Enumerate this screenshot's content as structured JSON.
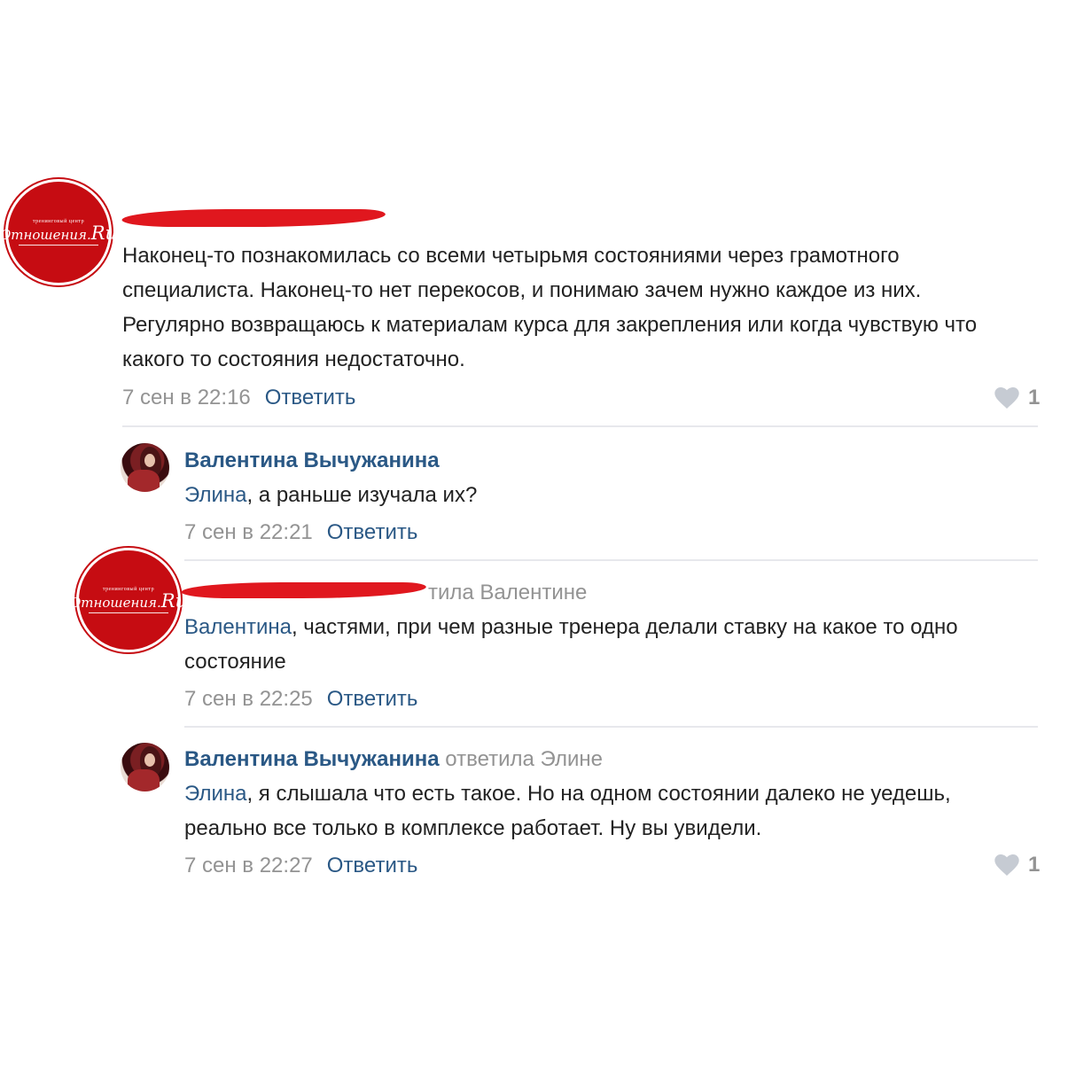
{
  "logo": {
    "small_text": "тренинговый центр",
    "script_text": "Отношения",
    "suffix": "Ru"
  },
  "comments": [
    {
      "author": "",
      "text": "Наконец-то познакомилась со всеми четырьмя состояниями через грамотного специалиста. Наконец-то нет перекосов, и понимаю зачем нужно каждое из них. Регулярно возвращаюсь к материалам курса для закрепления или когда чувствую что какого то состояния недостаточно.",
      "time": "7 сен в 22:16",
      "reply_label": "Ответить",
      "likes": "1"
    },
    {
      "author": "Валентина Вычужанина",
      "mention": "Элина",
      "text": ", а раньше изучала их?",
      "time": "7 сен в 22:21",
      "reply_label": "Ответить"
    },
    {
      "author_suffix": "тила Валентине",
      "mention": "Валентина",
      "text": ", частями, при чем разные тренера делали ставку на какое то одно состояние",
      "time": "7 сен в 22:25",
      "reply_label": "Ответить"
    },
    {
      "author": "Валентина Вычужанина",
      "replied_to": "ответила Элине",
      "mention": "Элина",
      "text": ", я слышала что есть такое. Но на одном состоянии далеко не уедешь, реально все только в комплексе работает. Ну вы увидели.",
      "time": "7 сен в 22:27",
      "reply_label": "Ответить",
      "likes": "1"
    }
  ],
  "colors": {
    "link": "#2a5885",
    "meta": "#939393",
    "logo_red": "#c60c12",
    "redaction": "#e0171e"
  }
}
